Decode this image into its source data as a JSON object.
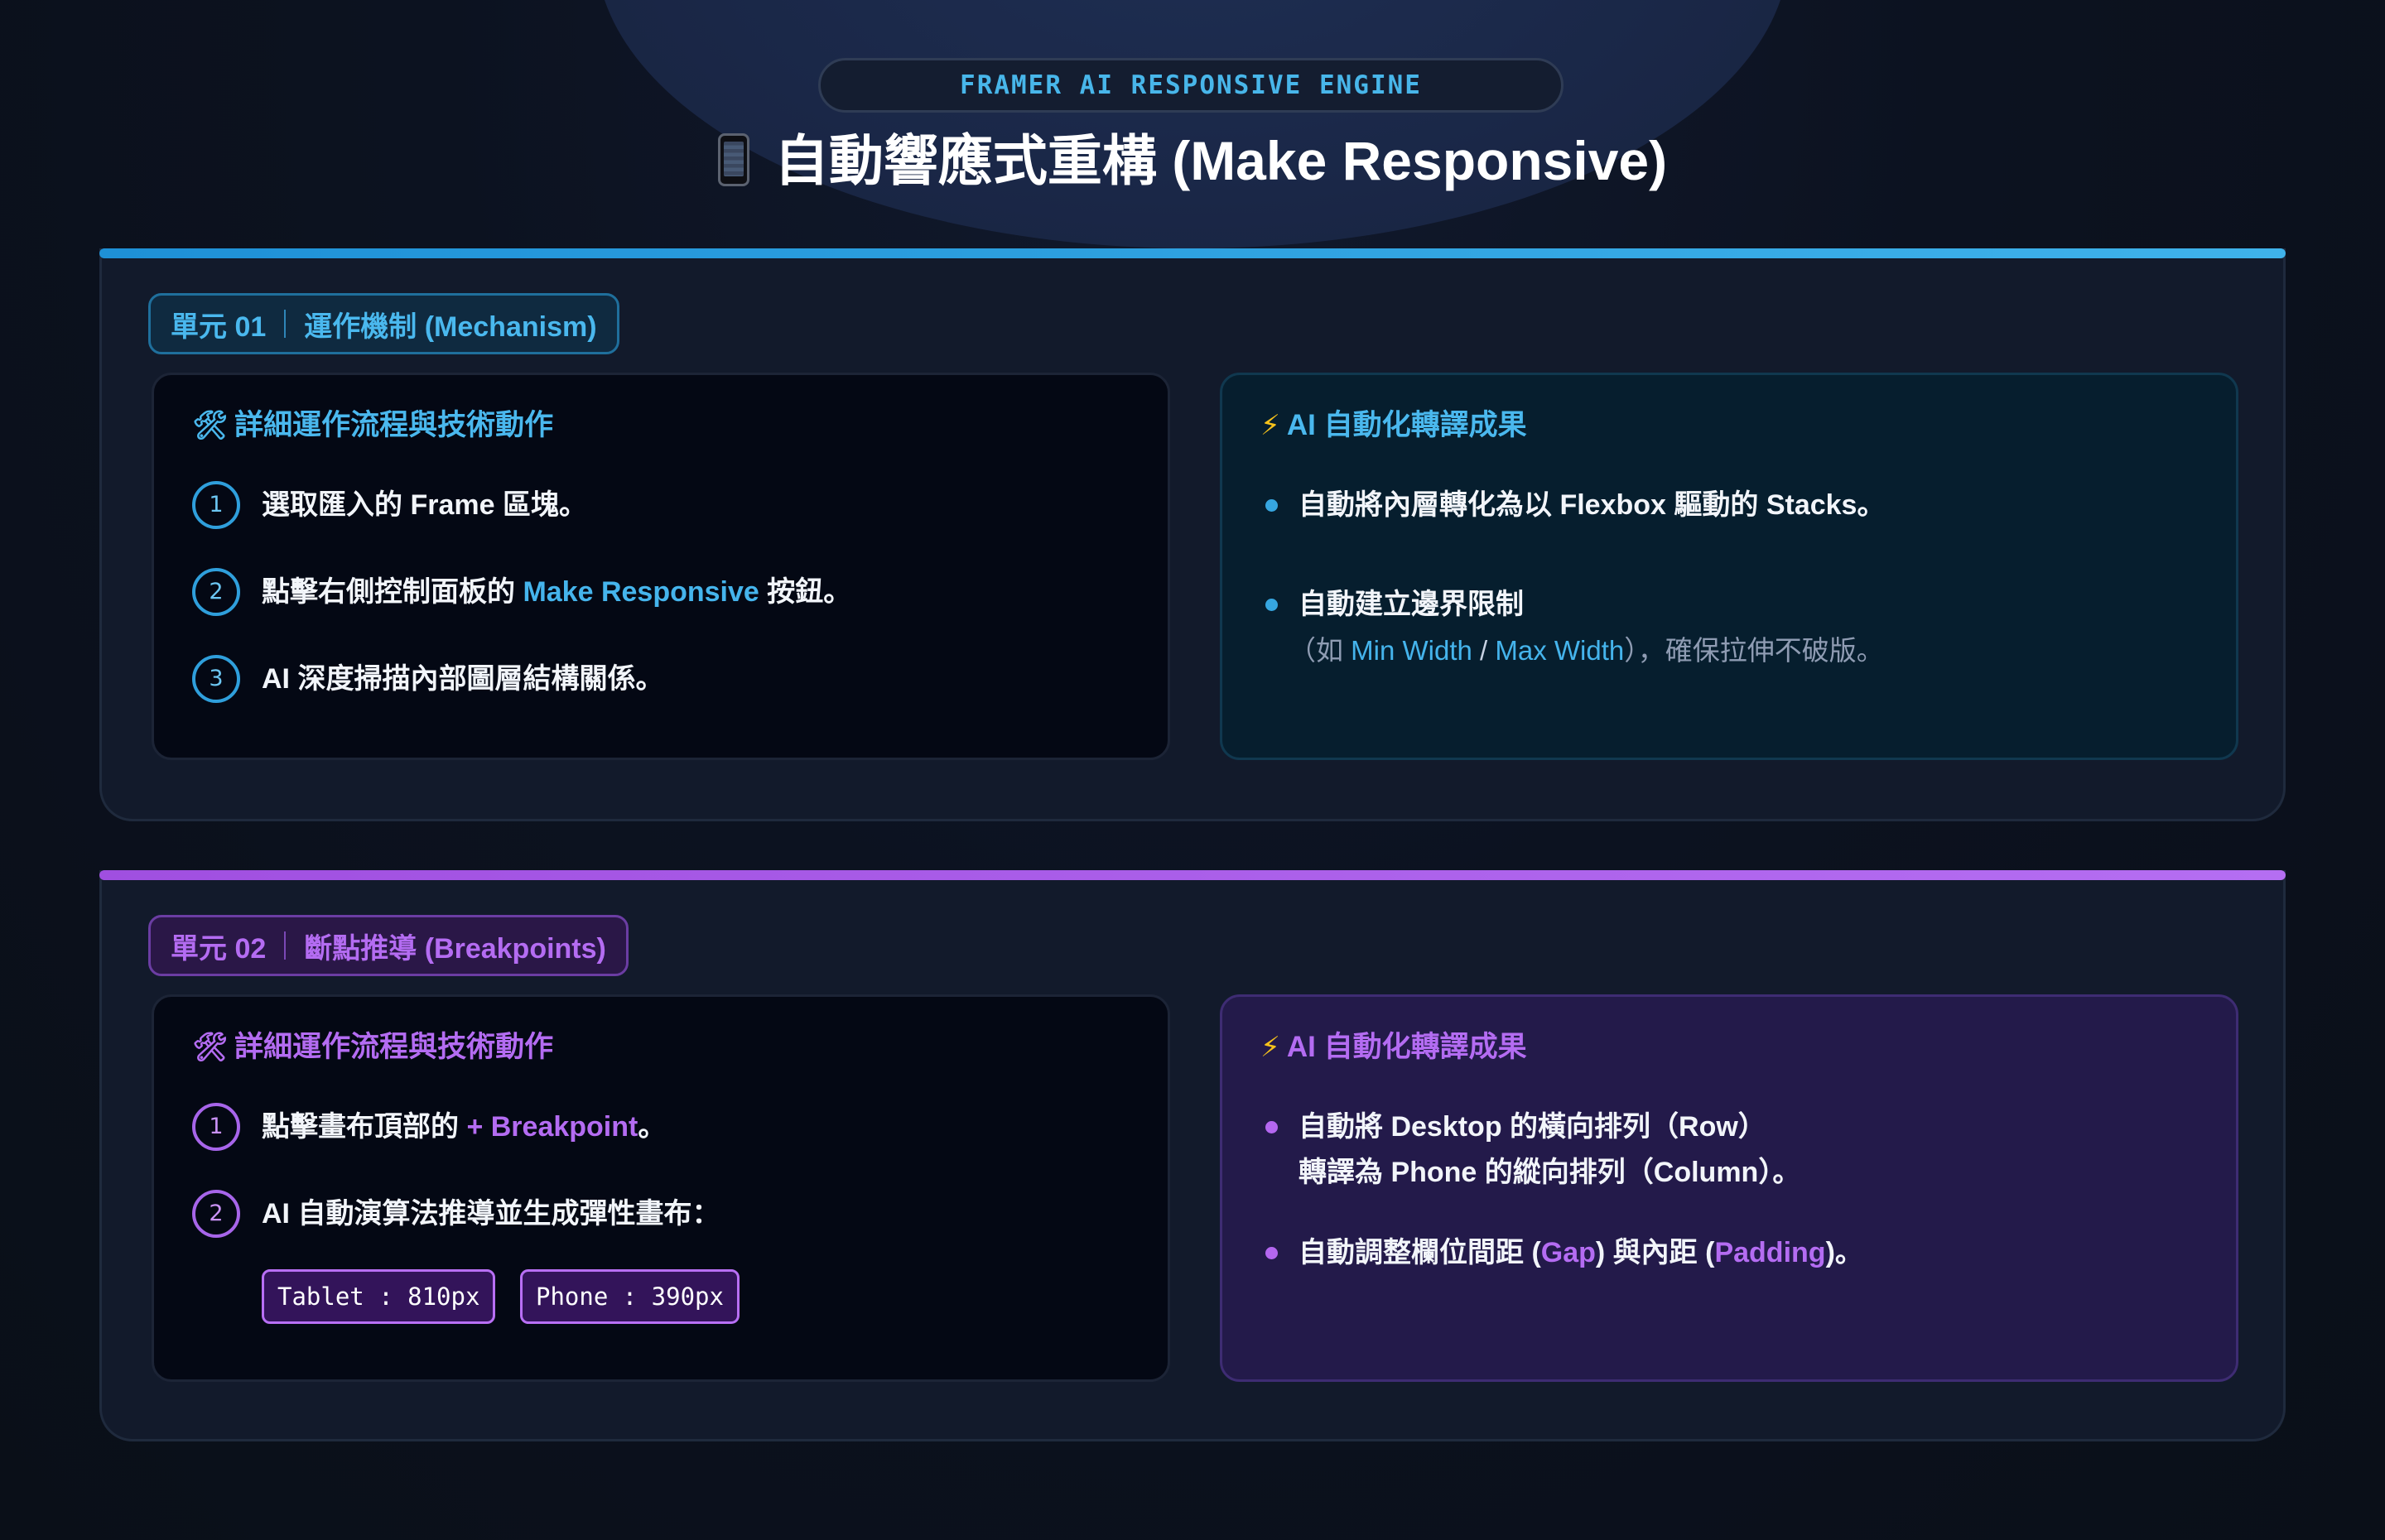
{
  "header": {
    "subtitle": "FRAMER AI RESPONSIVE ENGINE",
    "title": "自動響應式重構 (Make Responsive)",
    "title_icon": "mobile-phone-icon"
  },
  "units": [
    {
      "accent": "#36a6e0",
      "badge": {
        "number": "單元 01",
        "name": "運作機制 (Mechanism)"
      },
      "left_panel": {
        "heading_icon": "tools-icon",
        "heading": "詳細運作流程與技術動作",
        "steps": [
          {
            "num": "1",
            "text": "選取匯入的 Frame 區塊。"
          },
          {
            "num": "2",
            "pre": "點擊右側控制面板的 ",
            "highlight": "Make Responsive",
            "post": " 按鈕。"
          },
          {
            "num": "3",
            "text": "AI 深度掃描內部圖層結構關係。"
          }
        ]
      },
      "right_panel": {
        "heading_icon": "lightning-icon",
        "heading": "AI 自動化轉譯成果",
        "bullets": [
          {
            "text": "自動將內層轉化為以 Flexbox 驅動的 Stacks。"
          },
          {
            "text": "自動建立邊界限制",
            "sub_pre": "（如 ",
            "sub_min": "Min Width",
            "sub_slash": " / ",
            "sub_max": "Max Width",
            "sub_post": "），確保拉伸不破版。"
          }
        ]
      }
    },
    {
      "accent": "#b467f0",
      "badge": {
        "number": "單元 02",
        "name": "斷點推導 (Breakpoints)"
      },
      "left_panel": {
        "heading_icon": "tools-icon",
        "heading": "詳細運作流程與技術動作",
        "steps": [
          {
            "num": "1",
            "pre": "點擊畫布頂部的 ",
            "highlight": "+ Breakpoint",
            "post": "。"
          },
          {
            "num": "2",
            "text": "AI 自動演算法推導並生成彈性畫布："
          }
        ],
        "chips": [
          "Tablet : 810px",
          "Phone : 390px"
        ]
      },
      "right_panel": {
        "heading_icon": "lightning-icon",
        "heading": "AI 自動化轉譯成果",
        "bullets": [
          {
            "line1": "自動將 Desktop 的橫向排列（Row）",
            "line2": "轉譯為 Phone 的縱向排列（Column）。"
          },
          {
            "pre": "自動調整欄位間距 (",
            "gap": "Gap",
            "mid": ") 與內距 (",
            "padding": "Padding",
            "post": ")。"
          }
        ]
      }
    }
  ]
}
